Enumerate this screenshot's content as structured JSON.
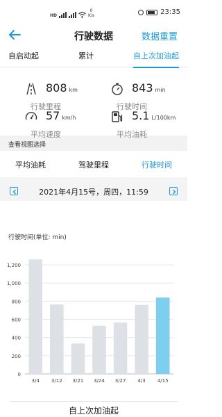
{
  "status_bar": {
    "net_speed": "0\nK/s",
    "time": "23:35",
    "tag": "HD"
  },
  "header": {
    "title": "行驶数据",
    "reset_label": "数据重置"
  },
  "top_tabs": [
    {
      "label": "自启动起",
      "active": false
    },
    {
      "label": "累计",
      "active": false
    },
    {
      "label": "自上次加油起",
      "active": true
    }
  ],
  "stats": {
    "distance": {
      "value": "808",
      "unit": "km",
      "label": "行驶里程",
      "icon": "road-icon"
    },
    "time": {
      "value": "843",
      "unit": "min",
      "label": "行驶时间",
      "icon": "stopwatch-icon"
    },
    "speed": {
      "value": "57",
      "unit": "km/h",
      "label": "平均速度",
      "icon": "speedometer-icon"
    },
    "fuel": {
      "value": "5.1",
      "unit": "L/100km",
      "label": "平均油耗",
      "icon": "fuel-pump-icon"
    }
  },
  "section_label": "查看视图选择",
  "view_tabs": [
    {
      "label": "平均油耗",
      "active": false
    },
    {
      "label": "驾驶里程",
      "active": false
    },
    {
      "label": "行驶时间",
      "active": true
    }
  ],
  "date_text": "2021年4月15号，周四，11:59",
  "chart_title": "行驶时间(单位: min)",
  "chart_data": {
    "type": "bar",
    "categories": [
      "3/4",
      "3/12",
      "3/21",
      "3/24",
      "3/27",
      "4/3",
      "4/15"
    ],
    "values": [
      1260,
      765,
      335,
      530,
      565,
      760,
      840
    ],
    "highlight_index": 6,
    "ylim": [
      0,
      1300
    ],
    "yticks": [
      0,
      200,
      400,
      600,
      800,
      1000,
      1200
    ],
    "ytick_labels": [
      "0",
      "200",
      "400",
      "600",
      "800",
      "1,000",
      "1,200"
    ],
    "bar_color": "#dde1e5",
    "highlight_color": "#7ccfee",
    "grid": true
  },
  "bottom_button": "自上次加油起",
  "colors": {
    "accent": "#1a9ad8"
  }
}
